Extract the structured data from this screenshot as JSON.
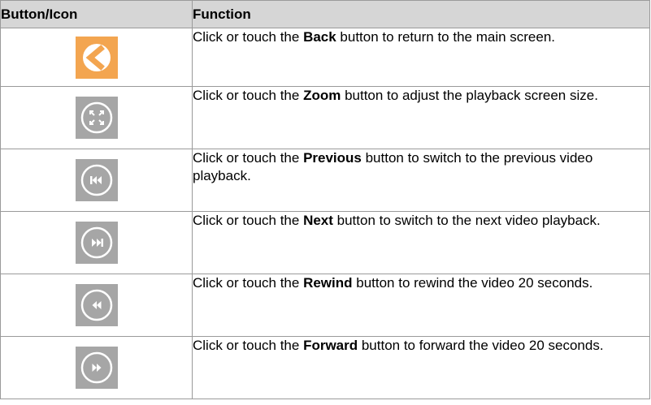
{
  "table": {
    "headers": {
      "icon_col": "Button/Icon",
      "function_col": "Function"
    },
    "rows": [
      {
        "icon": "back-icon",
        "before": "Click or touch the ",
        "keyword": "Back",
        "after": " button to return to the main screen."
      },
      {
        "icon": "zoom-icon",
        "before": "Click or touch the ",
        "keyword": "Zoom",
        "after": " button to adjust the playback screen size."
      },
      {
        "icon": "previous-icon",
        "before": "Click or touch the ",
        "keyword": "Previous",
        "after": " button to switch to the previous video playback."
      },
      {
        "icon": "next-icon",
        "before": "Click or touch the ",
        "keyword": "Next",
        "after": " button to switch to the next video playback."
      },
      {
        "icon": "rewind-icon",
        "before": "Click or touch the ",
        "keyword": "Rewind",
        "after": " button to rewind the video 20 seconds."
      },
      {
        "icon": "forward-icon",
        "before": "Click or touch the ",
        "keyword": "Forward",
        "after": " button to forward the video 20 seconds."
      }
    ]
  },
  "colors": {
    "back_tile": "#f3a550",
    "control_tile": "#a6a6a6",
    "header_bg": "#d6d6d6",
    "border": "#9a9a9a"
  }
}
